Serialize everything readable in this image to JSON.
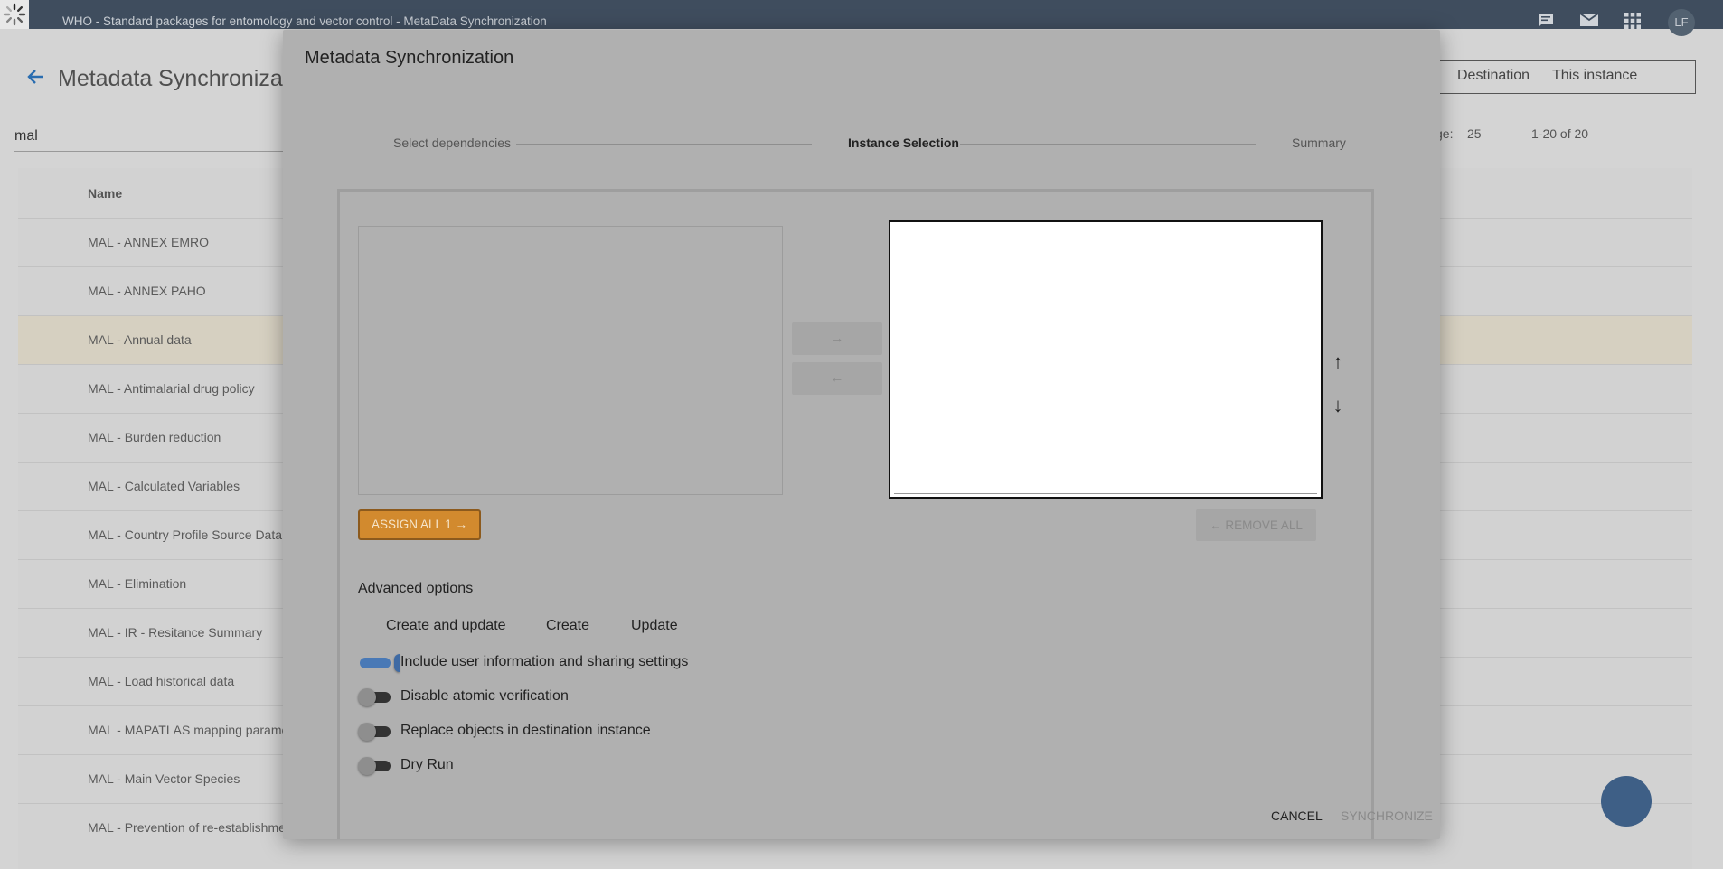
{
  "app": {
    "title": "WHO - Standard packages for entomology and vector control - MetaData Synchronization",
    "user_initials": "LF"
  },
  "page": {
    "title": "Metadata Synchronization",
    "search_value": "mal",
    "segments": [
      "Destination",
      "This instance"
    ],
    "rows_per_page_label": "ge:",
    "rows_per_page": "25",
    "range": "1-20 of 20",
    "table": {
      "column_name": "Name",
      "rows": [
        "MAL - ANNEX EMRO",
        "MAL - ANNEX PAHO",
        "MAL - Annual data",
        "MAL - Antimalarial drug policy",
        "MAL - Burden reduction",
        "MAL - Calculated Variables",
        "MAL - Country Profile Source Data",
        "MAL - Elimination",
        "MAL - IR - Resitance Summary",
        "MAL - Load historical data",
        "MAL - MAPATLAS mapping parame",
        "MAL - Main Vector Species",
        "MAL - Prevention of re-establishme"
      ],
      "highlighted_row": "MAL - Annual data"
    }
  },
  "dialog": {
    "title": "Metadata Synchronization",
    "steps": [
      "Select dependencies",
      "Instance Selection",
      "Summary"
    ],
    "active_step": "Instance Selection",
    "transfer": {
      "assign_right": "→",
      "assign_left": "←",
      "move_up": "↑",
      "move_down": "↓",
      "assign_all_label": "ASSIGN ALL 1 →",
      "remove_all_label": "← REMOVE ALL"
    },
    "advanced": {
      "title": "Advanced options",
      "strategies": [
        "Create and update",
        "Create",
        "Update"
      ],
      "toggles": [
        {
          "label": "Include user information and sharing settings",
          "on": true
        },
        {
          "label": "Disable atomic verification",
          "on": false
        },
        {
          "label": "Replace objects in destination instance",
          "on": false
        },
        {
          "label": "Dry Run",
          "on": false
        }
      ]
    },
    "actions": {
      "cancel": "CANCEL",
      "synchronize": "SYNCHRONIZE"
    }
  },
  "colors": {
    "topbar": "#3f4d5e",
    "primary": "#4979b6",
    "accent": "#d28a2e",
    "overlay_dialog": "#b0b0b0"
  }
}
